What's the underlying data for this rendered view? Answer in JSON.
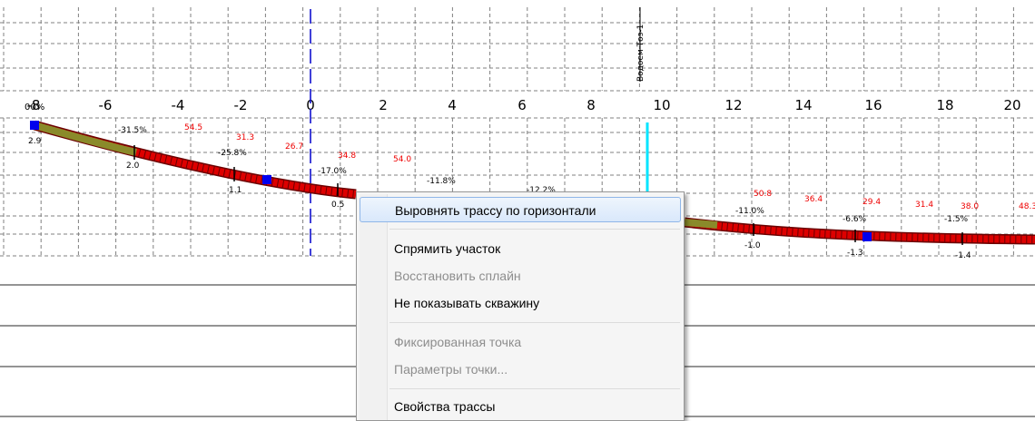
{
  "profile": {
    "x_ticks": [
      "-8",
      "-6",
      "-4",
      "-2",
      "0",
      "2",
      "4",
      "6",
      "8",
      "10",
      "12",
      "14",
      "16",
      "18",
      "20"
    ],
    "top_left_label": "00%",
    "obstacle_label": "Водоем Тоз-1",
    "slope_labels": [
      "-31.5%",
      "-25.8%",
      "-17.0%",
      "-11.8%",
      "-12.2%",
      "-11.0%",
      "-6.6%",
      "-1.5%"
    ],
    "red_labels": [
      "54.5",
      "31.3",
      "26.7",
      "34.8",
      "54.0",
      "50.8",
      "36.4",
      "29.4",
      "31.4",
      "38.0",
      "48.3"
    ],
    "depth_labels": [
      "2.9",
      "2.0",
      "1.1",
      "0.5",
      "-1.0",
      "-1.3",
      "-1.4"
    ],
    "colors": {
      "route": "#dd0000",
      "route_outline": "#6b0000",
      "start_segment": "#8a8a2a",
      "node": "#0000ee",
      "grid": "#808080",
      "center_line": "#0000cc",
      "water_line": "#00e5ff"
    }
  },
  "context_menu": {
    "items": [
      {
        "label": "Выровнять трассу по горизонтали",
        "enabled": true,
        "highlighted": true
      },
      {
        "label": "Спрямить участок",
        "enabled": true
      },
      {
        "label": "Восстановить сплайн",
        "enabled": false
      },
      {
        "label": "Не показывать скважину",
        "enabled": true
      },
      {
        "label": "Фиксированная точка",
        "enabled": false
      },
      {
        "label": "Параметры точки...",
        "enabled": false
      },
      {
        "label": "Свойства трассы",
        "enabled": true
      }
    ]
  }
}
